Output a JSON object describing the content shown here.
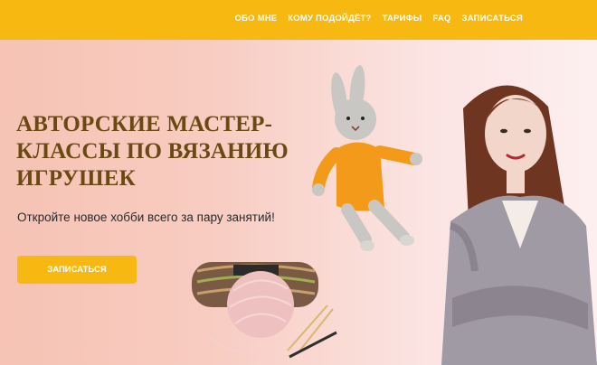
{
  "nav": {
    "items": [
      {
        "label": "ОБО МНЕ"
      },
      {
        "label": "КОМУ ПОДОЙДЁТ?"
      },
      {
        "label": "ТАРИФЫ"
      },
      {
        "label": "FAQ"
      },
      {
        "label": "ЗАПИСАТЬСЯ"
      }
    ]
  },
  "hero": {
    "title": "АВТОРСКИЕ МАСТЕР-КЛАССЫ ПО ВЯЗАНИЮ ИГРУШЕК",
    "subtitle": "Откройте новое хобби всего за пару занятий!",
    "cta_label": "ЗАПИСАТЬСЯ"
  },
  "colors": {
    "accent": "#f7b811",
    "title": "#6a4a12",
    "background_pink": "#f6c3b4"
  }
}
